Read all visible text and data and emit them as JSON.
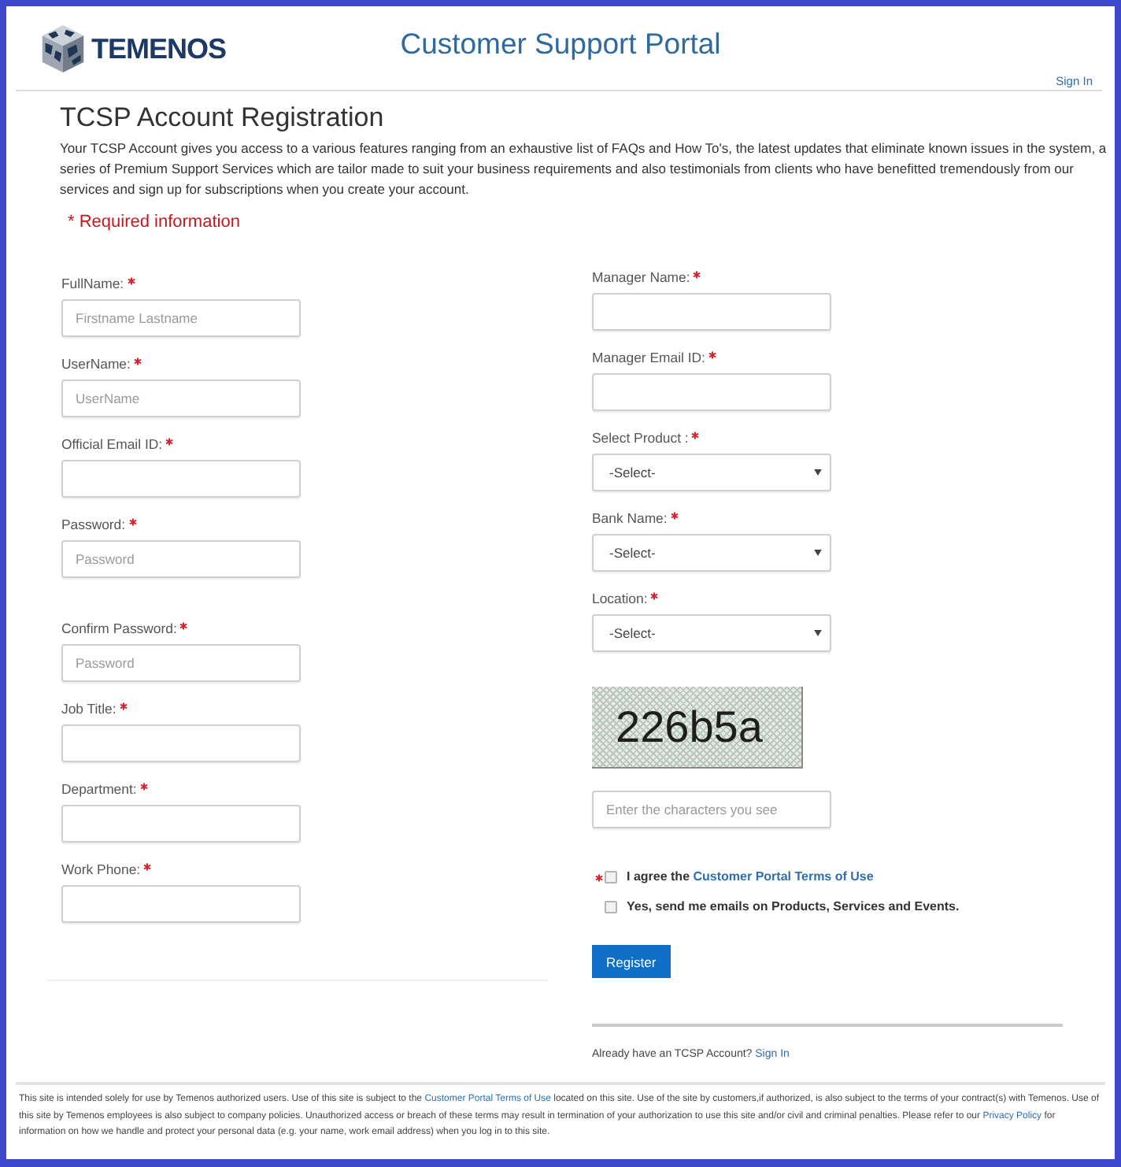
{
  "header": {
    "logo_text": "TEMENOS",
    "title": "Customer Support Portal",
    "sign_in": "Sign In"
  },
  "page": {
    "title": "TCSP Account Registration",
    "intro": "Your TCSP Account gives you access to a various features ranging from an exhaustive list of FAQs and How To's, the latest updates that eliminate known issues in the system, a series of Premium Support Services which are tailor made to suit your business requirements and also testimonials from clients who have benefitted tremendously from our services and sign up for subscriptions when you create your account.",
    "required_note": "* Required information"
  },
  "form": {
    "left_fields": [
      {
        "label": "FullName:",
        "required": true,
        "kind": "text",
        "placeholder": "Firstname Lastname"
      },
      {
        "label": "UserName:",
        "required": true,
        "kind": "text",
        "placeholder": "UserName"
      },
      {
        "label": "Official Email ID:",
        "required": true,
        "kind": "text"
      },
      {
        "label": "Password:",
        "required": true,
        "kind": "text",
        "placeholder": "Password"
      },
      {
        "label": "Confirm Password:",
        "required": true,
        "kind": "text",
        "placeholder": "Password"
      },
      {
        "label": "Job Title:",
        "required": true,
        "kind": "text"
      },
      {
        "label": "Department:",
        "required": true,
        "kind": "text"
      },
      {
        "label": "Work Phone:",
        "required": true,
        "kind": "text"
      }
    ],
    "right_fields": [
      {
        "label": "Manager Name:",
        "required": true,
        "kind": "text"
      },
      {
        "label": "Manager Email ID:",
        "required": true,
        "kind": "text"
      },
      {
        "label": "Select Product :",
        "required": true,
        "kind": "select",
        "value": "-Select-"
      },
      {
        "label": "Bank Name:",
        "required": true,
        "kind": "select",
        "value": "-Select-"
      },
      {
        "label": "Location:",
        "required": true,
        "kind": "select",
        "value": "-Select-"
      }
    ],
    "captcha": {
      "text": "226b5a",
      "placeholder": "Enter the characters you see"
    },
    "checkboxes": [
      {
        "required": true,
        "checked": false,
        "label": "I agree the",
        "link": "Customer Portal Terms of Use"
      },
      {
        "required": false,
        "checked": false,
        "label": "Yes, send me emails on Products, Services and Events."
      }
    ],
    "submit": "Register",
    "signin_prompt": {
      "text": "Already have an TCSP Account?",
      "link": "Sign In"
    }
  },
  "footer": {
    "parts": [
      {
        "kind": "text",
        "text": "This site is intended solely for use by Temenos authorized users. Use of this site is subject to the"
      },
      {
        "kind": "link",
        "text": "Customer Portal Terms of Use"
      },
      {
        "kind": "text",
        "text": "located on this site. Use of the site by customers,if authorized, is also subject to the terms of your contract(s) with Temenos. Use of this site by Temenos employees is also subject to company policies. Unauthorized access or breach of these terms may result in termination of your authorization to use this site and/or civil and criminal penalties. Please refer to our"
      },
      {
        "kind": "link",
        "text": "Privacy Policy"
      },
      {
        "kind": "text",
        "text": "for information on how we handle and protect your personal data (e.g. your name, work email address) when you log in to this site."
      }
    ]
  }
}
